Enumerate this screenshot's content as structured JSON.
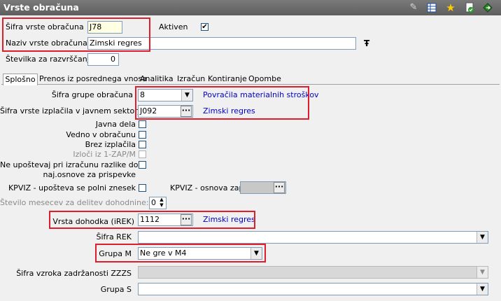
{
  "window": {
    "title": "Vrste obračuna"
  },
  "toolbar": {
    "icons": [
      "edit-icon",
      "grid-icon",
      "star-icon",
      "document-check-icon",
      "export-icon"
    ]
  },
  "header": {
    "sifra_label": "Šifra vrste obračuna",
    "sifra_value": "J78",
    "aktiven_label": "Aktiven",
    "aktiven_checked": "✔",
    "naziv_label": "Naziv vrste obračuna",
    "naziv_value": "Zimski regres",
    "stevilka_label": "Številka  za razvrščanje",
    "stevilka_value": "0"
  },
  "tabs": [
    {
      "label": "Splošno",
      "active": true
    },
    {
      "label": "Prenos iz posrednega vnosa"
    },
    {
      "label": "Analitika"
    },
    {
      "label": "Izračun"
    },
    {
      "label": "Kontiranje"
    },
    {
      "label": "Opombe"
    }
  ],
  "form": {
    "sifra_grupe_label": "Šifra grupe obračuna",
    "sifra_grupe_value": "8",
    "sifra_grupe_desc": "Povračila materialnih stroškov",
    "sifra_izplacila_label": "Šifra vrste izplačila v javnem sektorju",
    "sifra_izplacila_value": "J092",
    "sifra_izplacila_desc": "Zimski regres",
    "javna_dela_label": "Javna dela",
    "vedno_label": "Vedno v obračunu",
    "brez_label": "Brez izplačila",
    "izloci_label": "Izloči iz 1-ZAP/M",
    "ne_upostevaj_label_1": "Ne upoštevaj pri izračunu razlike do",
    "ne_upostevaj_label_2": "naj.osnove za prispevke",
    "kpviz_polni_label": "KPVIZ - upošteva se polni znesek",
    "kpviz_osnova_label": "KPVIZ - osnova zap.",
    "stevilo_mesecev_label": "Število mesecev za delitev dohodnine:",
    "stevilo_mesecev_value": "0",
    "vrsta_dohodka_label": "Vrsta dohodka (iREK)",
    "vrsta_dohodka_value": "1112",
    "vrsta_dohodka_desc": "Zimski regres",
    "sifra_rek_label": "Šifra REK",
    "sifra_rek_value": "",
    "grupa_m_label": "Grupa M",
    "grupa_m_value": "Ne gre v M4",
    "sifra_vzroka_label": "Šifra vzroka zadržanosti ZZZS",
    "sifra_vzroka_value": "",
    "grupa_s_label": "Grupa S",
    "grupa_s_value": ""
  },
  "colors": {
    "highlight": "#e01d2b",
    "link": "#0000cc",
    "titlebar": "#6a6a6a"
  }
}
